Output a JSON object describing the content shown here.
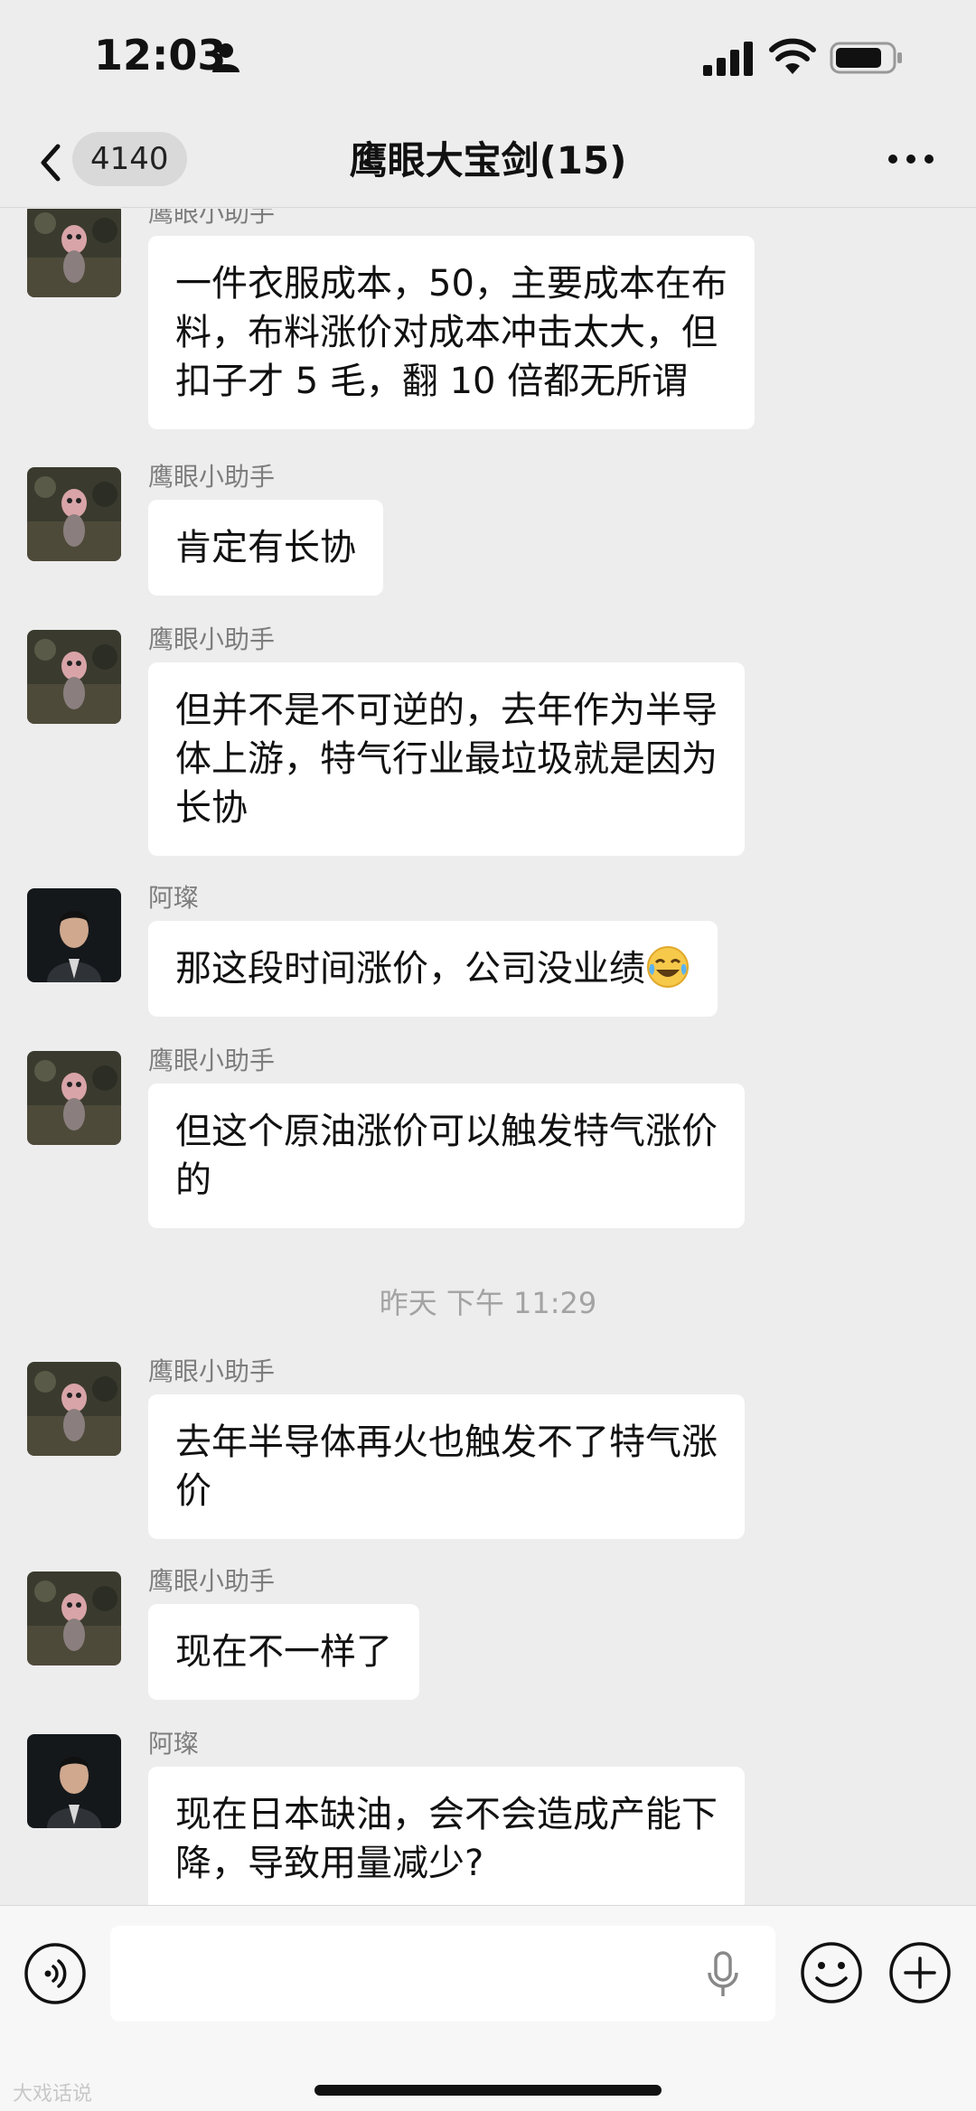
{
  "status_bar": {
    "time": "12:03"
  },
  "nav": {
    "back_count": "4140",
    "title": "鹰眼大宝剑(15)"
  },
  "messages": [
    {
      "sender": "鹰眼小助手",
      "avatar": "toy-figure-avatar",
      "lines": [
        "一件衣服成本，50，主要成本在布",
        "料，布料涨价对成本冲击太大，但",
        "扣子才 5 毛，翻 10 倍都无所谓"
      ]
    },
    {
      "sender": "鹰眼小助手",
      "avatar": "toy-figure-avatar",
      "lines": [
        "肯定有长协"
      ]
    },
    {
      "sender": "鹰眼小助手",
      "avatar": "toy-figure-avatar",
      "lines": [
        "但并不是不可逆的，去年作为半导",
        "体上游，特气行业最垃圾就是因为",
        "长协"
      ]
    },
    {
      "sender": "阿璨",
      "avatar": "man-suit-avatar",
      "lines": [
        "那这段时间涨价，公司没业绩"
      ],
      "emoji": "laughing-tears-emoji"
    },
    {
      "sender": "鹰眼小助手",
      "avatar": "toy-figure-avatar",
      "lines": [
        "但这个原油涨价可以触发特气涨价",
        "的"
      ]
    },
    {
      "sender": "鹰眼小助手",
      "avatar": "toy-figure-avatar",
      "lines": [
        "去年半导体再火也触发不了特气涨",
        "价"
      ]
    },
    {
      "sender": "鹰眼小助手",
      "avatar": "toy-figure-avatar",
      "lines": [
        "现在不一样了"
      ]
    },
    {
      "sender": "阿璨",
      "avatar": "man-suit-avatar",
      "lines": [
        "现在日本缺油，会不会造成产能下",
        "降，导致用量减少?"
      ]
    }
  ],
  "timestamp": "昨天 下午 11:29",
  "input_bar": {
    "message_value": ""
  },
  "watermark": "大戏话说",
  "colors": {
    "background": "#ededed",
    "bubble": "#ffffff",
    "sender": "#7d7d7d",
    "timestamp": "#a3a3a3"
  }
}
